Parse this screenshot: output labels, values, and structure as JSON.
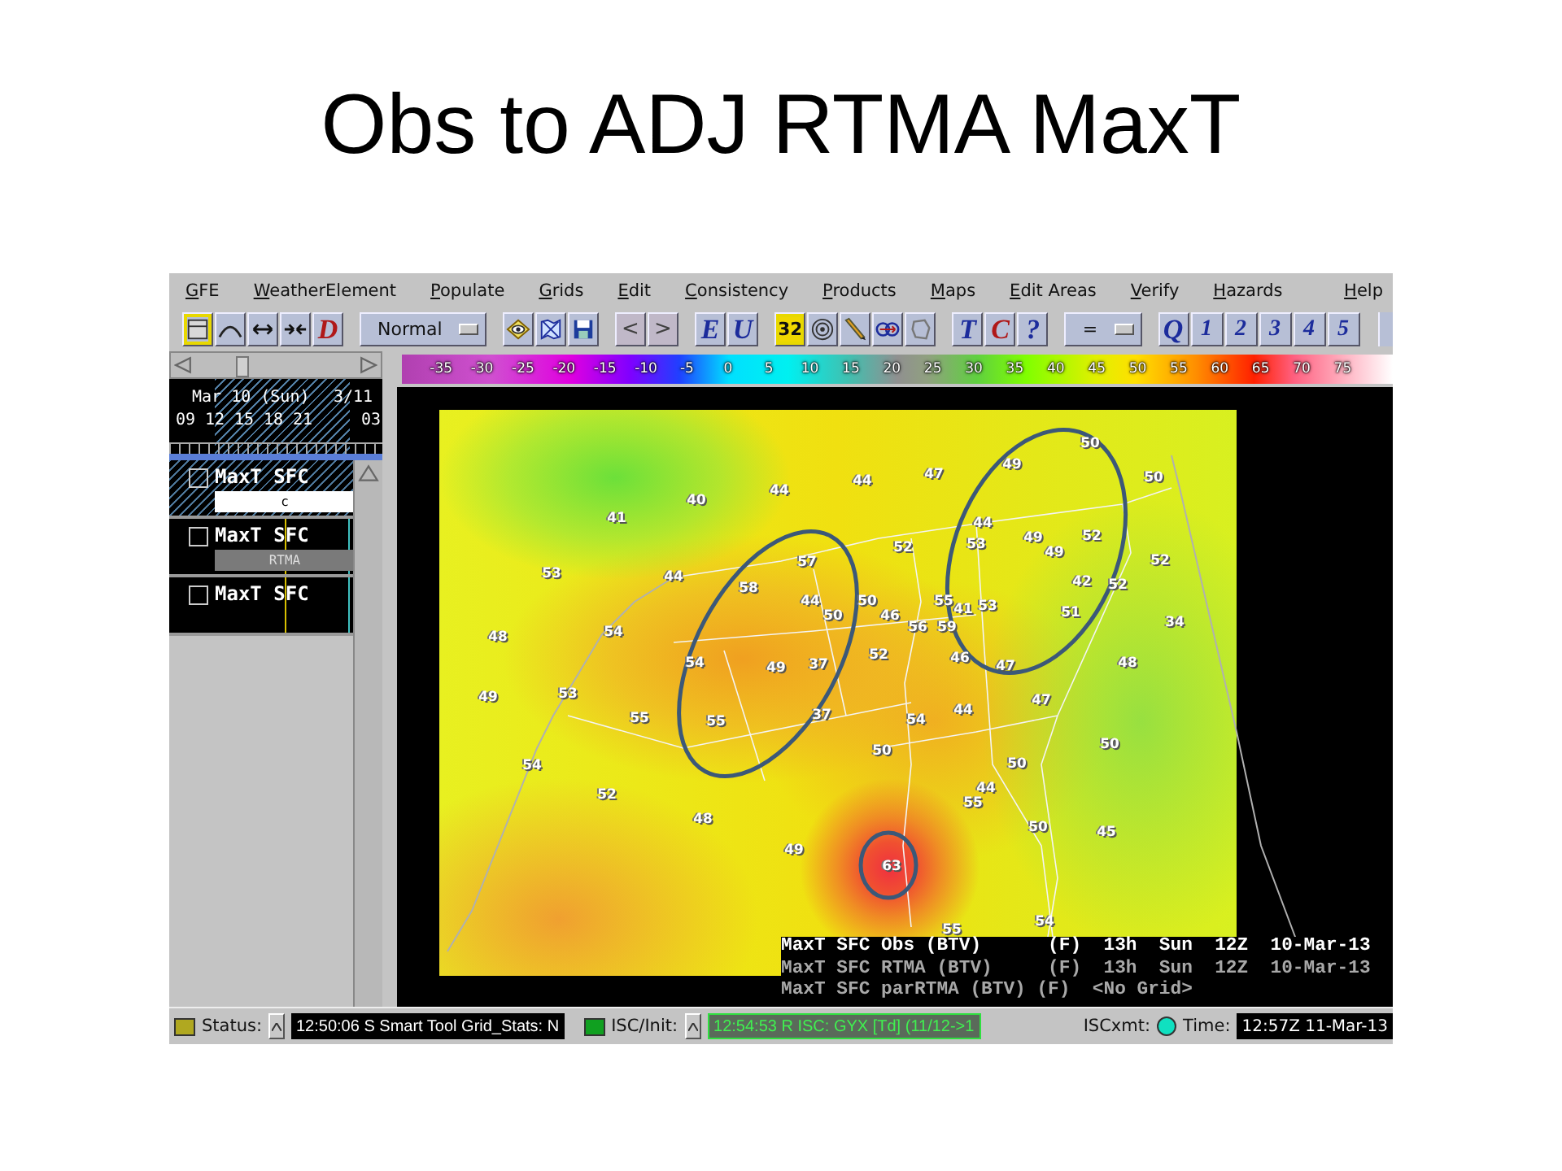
{
  "slide_title": "Obs to ADJ RTMA MaxT",
  "menu": [
    "GFE",
    "WeatherElement",
    "Populate",
    "Grids",
    "Edit",
    "Consistency",
    "Products",
    "Maps",
    "Edit Areas",
    "Verify",
    "Hazards"
  ],
  "help_menu": "Help",
  "toolbar": [
    [
      {
        "kind": "icon",
        "selected": true
      },
      {
        "kind": "icon",
        "selected": false
      },
      {
        "kind": "icon",
        "selected": false
      },
      {
        "kind": "icon",
        "selected": false
      },
      {
        "kind": "letter",
        "label": "D",
        "color": "#b01818",
        "selected": false
      }
    ],
    [
      {
        "kind": "dropdown",
        "value": "Normal",
        "selected": false
      }
    ],
    [
      {
        "kind": "icon",
        "selected": false
      },
      {
        "kind": "icon",
        "selected": false
      },
      {
        "kind": "icon",
        "selected": false
      }
    ],
    [
      {
        "kind": "arrow",
        "label": "<",
        "color": "#404040",
        "selected": false
      },
      {
        "kind": "arrow",
        "label": ">",
        "color": "#404040",
        "selected": false
      }
    ],
    [
      {
        "kind": "letter",
        "label": "E",
        "color": "#1c2c9c",
        "selected": false
      },
      {
        "kind": "letter",
        "label": "U",
        "color": "#1c2c9c",
        "selected": false
      }
    ],
    [
      {
        "kind": "letter",
        "label": "32",
        "selected": true
      },
      {
        "kind": "icon",
        "selected": false
      },
      {
        "kind": "icon",
        "selected": false
      },
      {
        "kind": "icon",
        "selected": false
      },
      {
        "kind": "icon",
        "selected": false
      }
    ],
    [
      {
        "kind": "letter",
        "label": "T",
        "color": "#1c2c9c",
        "selected": false
      },
      {
        "kind": "letter",
        "label": "C",
        "color": "#b01818",
        "selected": false
      },
      {
        "kind": "letter",
        "label": "?",
        "color": "#1c2c9c",
        "selected": false
      }
    ],
    [
      {
        "kind": "dropdown",
        "value": "=",
        "selected": false
      }
    ],
    [
      {
        "kind": "letter",
        "label": "Q",
        "color": "#1c2c9c",
        "selected": false
      },
      {
        "kind": "letter",
        "label": "1",
        "color": "#1c2c9c",
        "selected": false
      },
      {
        "kind": "letter",
        "label": "2",
        "color": "#1c2c9c",
        "selected": false
      },
      {
        "kind": "letter",
        "label": "3",
        "color": "#1c2c9c",
        "selected": false
      },
      {
        "kind": "letter",
        "label": "4",
        "color": "#1c2c9c",
        "selected": false
      },
      {
        "kind": "letter",
        "label": "5",
        "color": "#1c2c9c",
        "selected": false
      }
    ]
  ],
  "color_scale": [
    "-35",
    "-30",
    "-25",
    "-20",
    "-15",
    "-10",
    "-5",
    "0",
    "5",
    "10",
    "15",
    "20",
    "25",
    "30",
    "35",
    "40",
    "45",
    "50",
    "55",
    "60",
    "65",
    "70",
    "75"
  ],
  "time_slider": {
    "level": 0.34
  },
  "time_scale": {
    "date": "Mar 10 (Sun)",
    "next_date": "3/11",
    "hours": [
      "09",
      "12",
      "15",
      "18",
      "21",
      "03"
    ]
  },
  "grid_list": [
    {
      "name": "MaxT SFC",
      "selected": true,
      "tag": "c"
    },
    {
      "name": "MaxT SFC",
      "selected": false,
      "tag": "RTMA"
    },
    {
      "name": "MaxT SFC",
      "selected": false
    }
  ],
  "stations": [
    "41",
    "40",
    "44",
    "44",
    "47",
    "49",
    "50",
    "50",
    "53",
    "44",
    "58",
    "57",
    "52",
    "44",
    "53",
    "49",
    "49",
    "52",
    "52",
    "48",
    "54",
    "44",
    "50",
    "50",
    "46",
    "56",
    "55",
    "41",
    "53",
    "42",
    "52",
    "51",
    "34",
    "54",
    "49",
    "37",
    "52",
    "59",
    "46",
    "47",
    "48",
    "49",
    "53",
    "55",
    "55",
    "37",
    "54",
    "44",
    "47",
    "54",
    "50",
    "50",
    "50",
    "52",
    "44",
    "55",
    "48",
    "50",
    "45",
    "49",
    "63",
    "55",
    "54"
  ],
  "legend": [
    {
      "text": "MaxT SFC Obs (BTV)      (F)  13h  Sun  12Z  10-Mar-13",
      "color": "#ffffff"
    },
    {
      "text": "MaxT SFC RTMA (BTV)     (F)  13h  Sun  12Z  10-Mar-13",
      "color": "#a8a8a8"
    },
    {
      "text": "MaxT SFC parRTMA (BTV) (F)  <No Grid>",
      "color": "#a8a8a8"
    }
  ],
  "status_bar": {
    "status_label": "Status:",
    "status_message": "12:50:06 S Smart Tool Grid_Stats: N",
    "isc_label": "ISC/Init:",
    "isc_message": "12:54:53 R ISC: GYX [Td] (11/12->1",
    "xmt_label": "ISCxmt:",
    "time_label": "Time:",
    "time_value": "12:57Z 11-Mar-13"
  }
}
